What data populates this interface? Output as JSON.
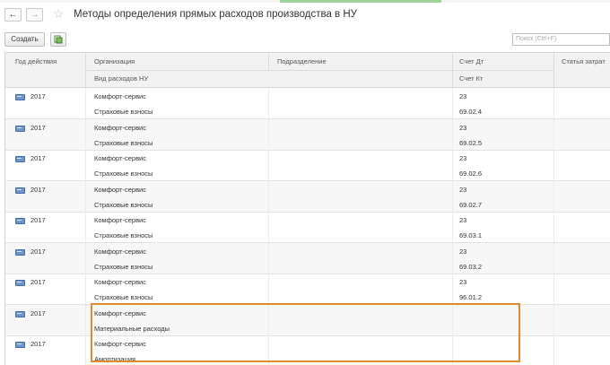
{
  "window": {
    "title": "Методы определения прямых расходов производства в НУ",
    "back_label": "←",
    "forward_label": "→",
    "favorite_icon": "star-icon"
  },
  "toolbar": {
    "create_label": "Создать",
    "copy_icon": "copy-doc-icon",
    "search_placeholder": "Поиск (Ctrl+F)"
  },
  "table": {
    "headers": {
      "year": "Год действия",
      "organization": "Организация",
      "expense_type": "Вид расходов НУ",
      "subdivision": "Подразделение",
      "account_dt": "Счет Дт",
      "account_kt": "Счет Кт",
      "cost_item": "Статья затрат"
    },
    "rows": [
      {
        "year": "2017",
        "organization": "Комфорт-сервис",
        "expense_type": "Страховые взносы",
        "account_dt": "23",
        "account_kt": "69.02.4"
      },
      {
        "year": "2017",
        "organization": "Комфорт-сервис",
        "expense_type": "Страховые взносы",
        "account_dt": "23",
        "account_kt": "69.02.5"
      },
      {
        "year": "2017",
        "organization": "Комфорт-сервис",
        "expense_type": "Страховые взносы",
        "account_dt": "23",
        "account_kt": "69.02.6"
      },
      {
        "year": "2017",
        "organization": "Комфорт-сервис",
        "expense_type": "Страховые взносы",
        "account_dt": "23",
        "account_kt": "69.02.7"
      },
      {
        "year": "2017",
        "organization": "Комфорт-сервис",
        "expense_type": "Страховые взносы",
        "account_dt": "23",
        "account_kt": "69.03.1"
      },
      {
        "year": "2017",
        "organization": "Комфорт-сервис",
        "expense_type": "Страховые взносы",
        "account_dt": "23",
        "account_kt": "69.03.2"
      },
      {
        "year": "2017",
        "organization": "Комфорт-сервис",
        "expense_type": "Страховые взносы",
        "account_dt": "23",
        "account_kt": "96.01.2"
      },
      {
        "year": "2017",
        "organization": "Комфорт-сервис",
        "expense_type": "Материальные расходы",
        "account_dt": "",
        "account_kt": ""
      },
      {
        "year": "2017",
        "organization": "Комфорт-сервис",
        "expense_type": "Амортизация",
        "account_dt": "",
        "account_kt": ""
      }
    ]
  },
  "colors": {
    "highlight": "#e28a2f",
    "row_icon": "#6f95c9",
    "header_bg": "#f2f2f2"
  }
}
